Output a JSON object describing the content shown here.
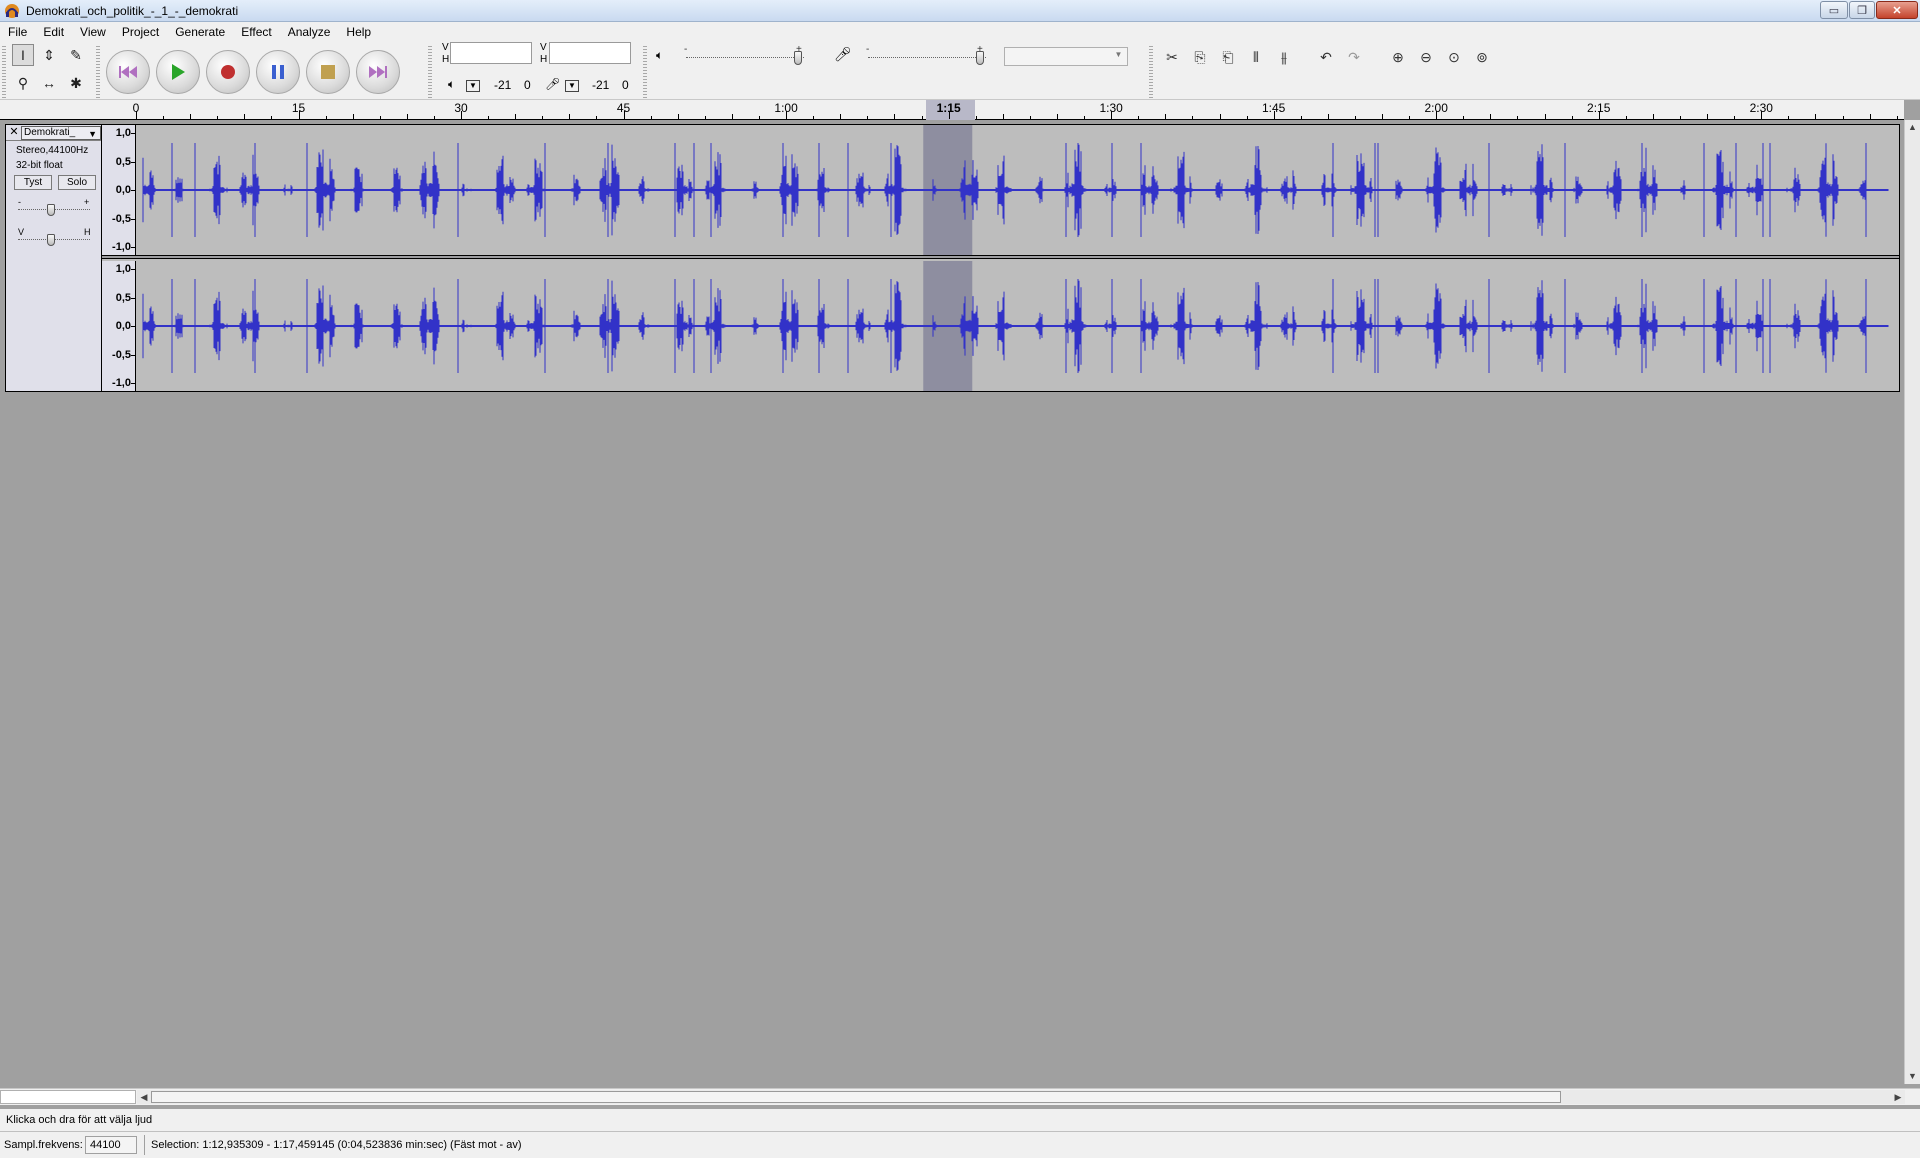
{
  "window": {
    "title": "Demokrati_och_politik_-_1_-_demokrati",
    "min_glyph": "▭",
    "max_glyph": "❐",
    "close_glyph": "✕"
  },
  "menu": [
    "File",
    "Edit",
    "View",
    "Project",
    "Generate",
    "Effect",
    "Analyze",
    "Help"
  ],
  "toolbar": {
    "tools": [
      {
        "name": "selection-tool",
        "glyph": "I",
        "active": true
      },
      {
        "name": "envelope-tool",
        "glyph": "⇕",
        "active": false
      },
      {
        "name": "draw-tool",
        "glyph": "✎",
        "active": false
      },
      {
        "name": "zoom-tool",
        "glyph": "⚲",
        "active": false
      },
      {
        "name": "timeshift-tool",
        "glyph": "↔",
        "active": false
      },
      {
        "name": "multi-tool",
        "glyph": "✱",
        "active": false
      }
    ],
    "meters": {
      "playback": {
        "v_label": "V",
        "h_label": "H",
        "min_label": "-21",
        "max_label": "0"
      },
      "record": {
        "v_label": "V",
        "h_label": "H",
        "min_label": "-21",
        "max_label": "0"
      }
    },
    "mixer": {
      "playback_volume": 0.95,
      "record_volume": 0.95,
      "minus": "-",
      "plus": "+"
    },
    "device_combo_value": "",
    "edit_glyphs": [
      "✂",
      "⎘",
      "⎗",
      "⫴",
      "⫵"
    ],
    "undo_glyph": "↶",
    "redo_glyph": "↷",
    "zoom_glyphs": [
      "⊕",
      "⊖",
      "⊙",
      "⊚"
    ],
    "colors": {
      "play": "#2aa52a",
      "record": "#c03030",
      "pause": "#3a5fd0",
      "stop": "#c0a050",
      "skip": "#b070c0"
    }
  },
  "ruler": {
    "labels": [
      "0",
      "15",
      "30",
      "45",
      "1:00",
      "1:15",
      "1:30",
      "1:45",
      "2:00",
      "2:15",
      "2:30"
    ],
    "seconds_per_label": 15
  },
  "track": {
    "name": "Demokrati_",
    "close_glyph": "✕",
    "menu_arrow": "▼",
    "format": "Stereo,44100Hz",
    "bit_depth": "32-bit float",
    "mute_label": "Tyst",
    "solo_label": "Solo",
    "gain_minus": "-",
    "gain_plus": "+",
    "pan_left": "V",
    "pan_right": "H",
    "scale_labels": [
      "1,0",
      "0,5",
      "0,0",
      "-0,5",
      "-1,0"
    ],
    "waveform_color": "#3232c8",
    "background_color": "#bdbdbd",
    "selection_color": "#8e8ea0",
    "duration_seconds": 162,
    "selection_seconds": [
      72.935,
      77.459
    ]
  },
  "status": {
    "message": "Klicka och dra för att välja ljud",
    "rate_label": "Sampl.frekvens:",
    "rate_value": "44100",
    "selection": "Selection: 1:12,935309 - 1:17,459145 (0:04,523836 min:sec)    (Fäst mot - av)"
  }
}
